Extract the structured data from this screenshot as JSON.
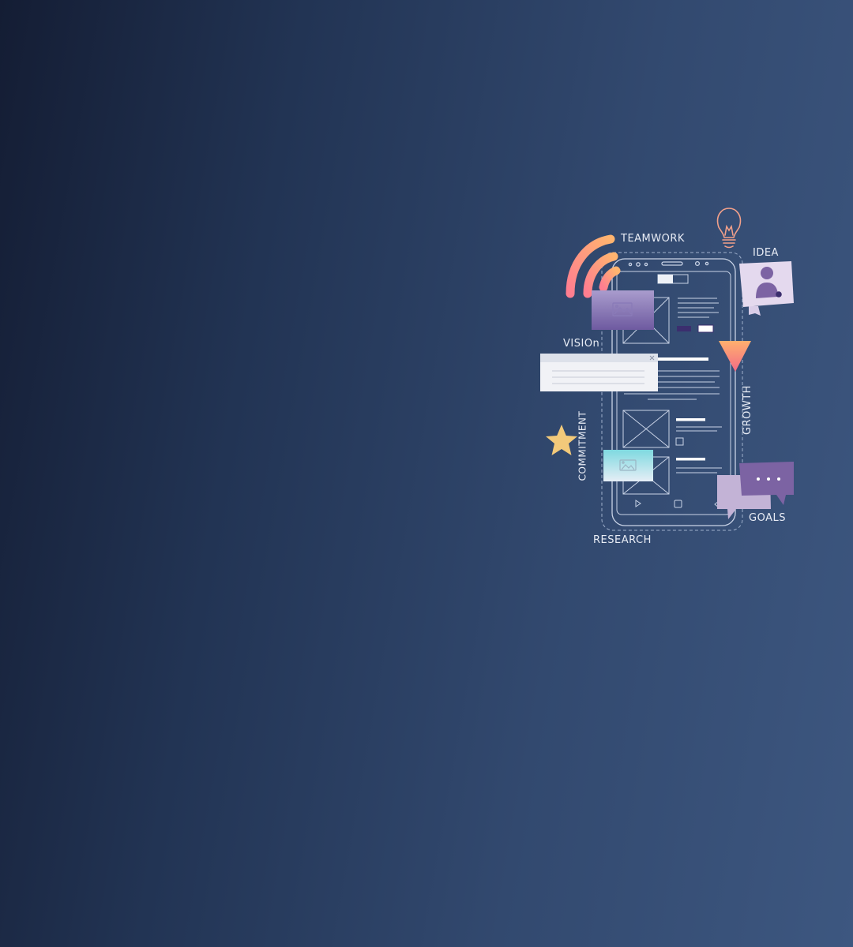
{
  "illustration": {
    "labels": {
      "teamwork": "TEAMWORK",
      "idea": "IDEA",
      "vision": "VISIOn",
      "growth": "GROWTH",
      "commitment": "COMMITMENT",
      "goals": "GOALS",
      "research": "RESEARCH"
    },
    "colors": {
      "bg_start": "#141d34",
      "bg_end": "#3d5780",
      "wifi_pink": "#ff7f8f",
      "wifi_orange": "#ffb870",
      "star": "#f2c97a",
      "bubble_purple": "#7c63a3",
      "bubble_lilac": "#c3b3d6",
      "card_lilac": "#e4d9ee",
      "outline": "#c9d3e6"
    },
    "icons": [
      "wifi-icon",
      "lightbulb-icon",
      "user-icon",
      "funnel-icon",
      "star-icon",
      "chat-bubble-icon",
      "image-icon",
      "close-icon"
    ]
  }
}
